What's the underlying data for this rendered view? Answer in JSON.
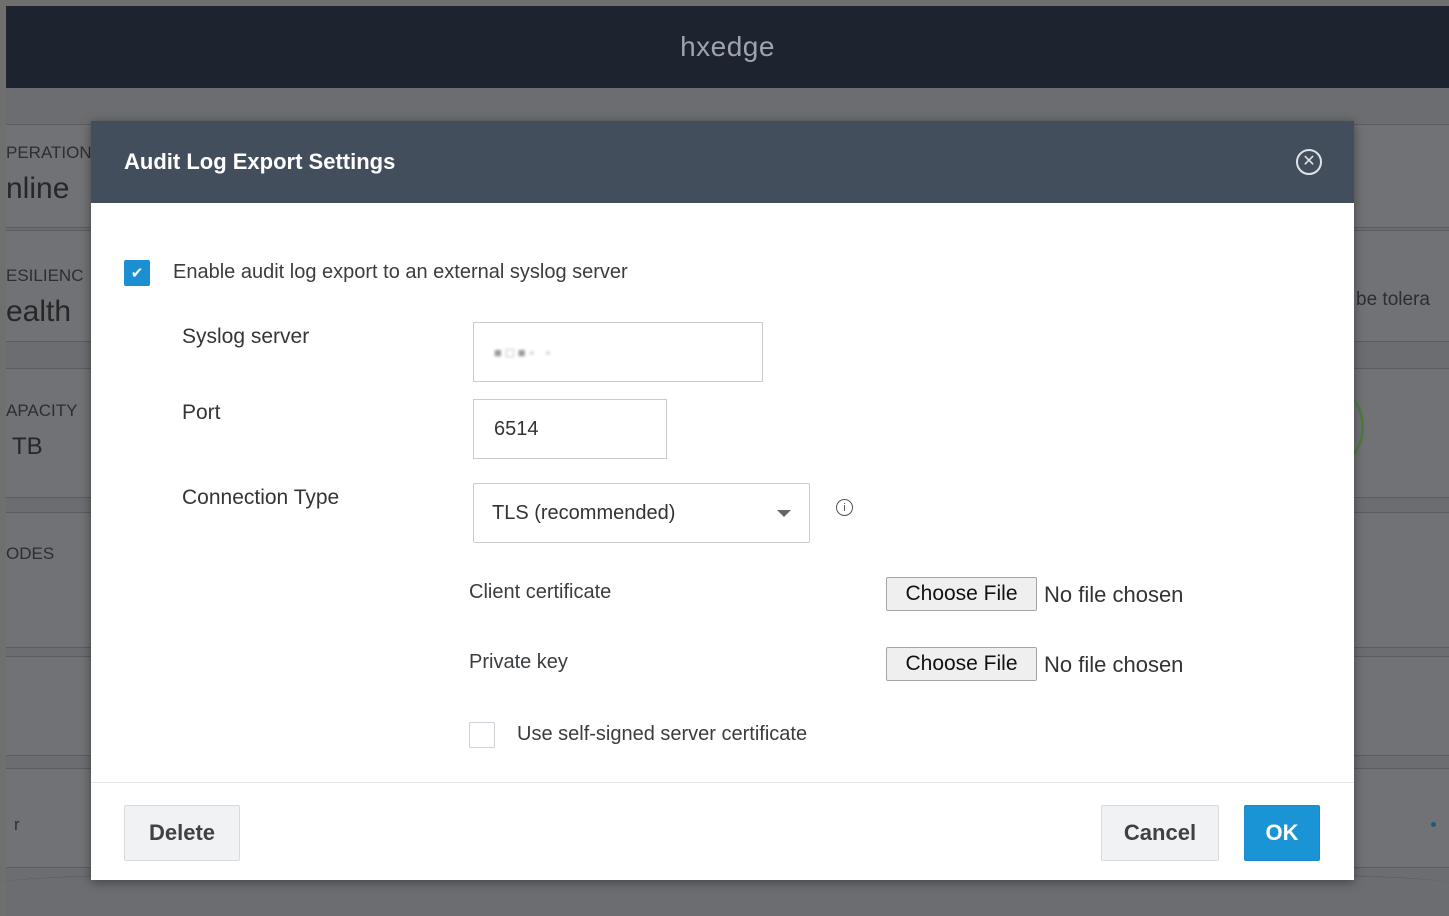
{
  "app": {
    "title": "hxedge"
  },
  "background": {
    "operational_label": "PERATION",
    "operational_value": "nline",
    "resiliency_label": "ESILIENC",
    "resiliency_value": "ealth",
    "resiliency_right_text": "be tolera",
    "capacity_label": "APACITY",
    "capacity_value": "TB",
    "nodes_label": "ODES",
    "bottom_left_text": "r"
  },
  "modal": {
    "title": "Audit Log Export Settings",
    "enable_label": "Enable audit log export to an external syslog server",
    "enable_checked": true,
    "syslog_server_label": "Syslog server",
    "syslog_server_value": "■□■▫ ▫",
    "port_label": "Port",
    "port_value": "6514",
    "connection_type_label": "Connection Type",
    "connection_type_value": "TLS (recommended)",
    "client_certificate_label": "Client certificate",
    "private_key_label": "Private key",
    "choose_file_label": "Choose File",
    "no_file_label": "No file chosen",
    "self_signed_label": "Use self-signed server certificate",
    "self_signed_checked": false,
    "delete_label": "Delete",
    "cancel_label": "Cancel",
    "ok_label": "OK"
  },
  "colors": {
    "header_bg": "#1e2330",
    "modal_header_bg": "#434e5d",
    "accent": "#1b94d6"
  }
}
